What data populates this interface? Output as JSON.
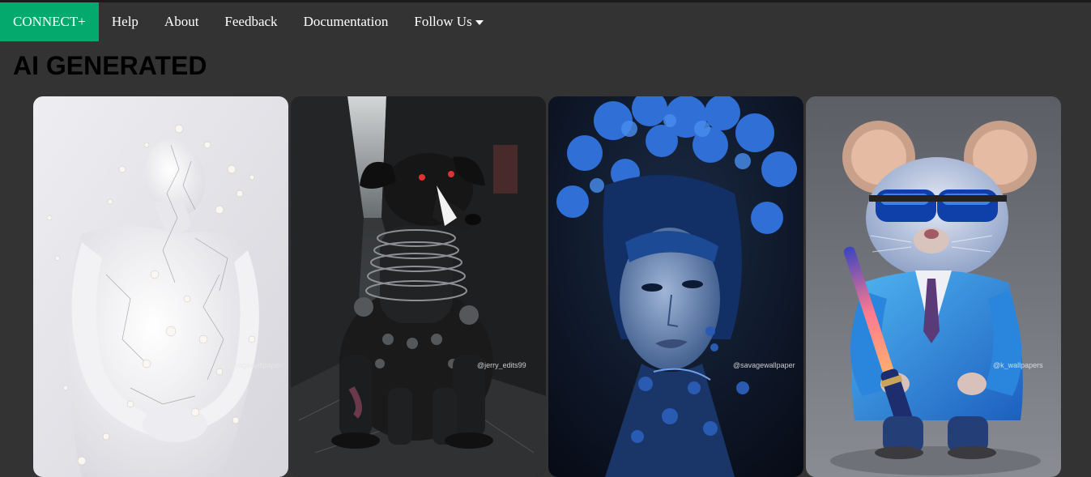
{
  "nav": {
    "brand": "CONNECT+",
    "items": [
      {
        "label": "Help"
      },
      {
        "label": "About"
      },
      {
        "label": "Feedback"
      },
      {
        "label": "Documentation"
      },
      {
        "label": "Follow Us"
      }
    ],
    "brand_color": "#04AA6D"
  },
  "page": {
    "title": "AI GENERATED"
  },
  "gallery": {
    "images": [
      {
        "subject": "white porcelain figure with blossoms",
        "watermark": "@savagewallpaper"
      },
      {
        "subject": "cyborg robotic dog in alley",
        "watermark": "@jerry_edits99"
      },
      {
        "subject": "blue floral fantasy woman portrait",
        "watermark": "@savagewallpaper"
      },
      {
        "subject": "mouse in blue suit with lightsaber",
        "watermark": "@k_wallpapers"
      }
    ]
  }
}
